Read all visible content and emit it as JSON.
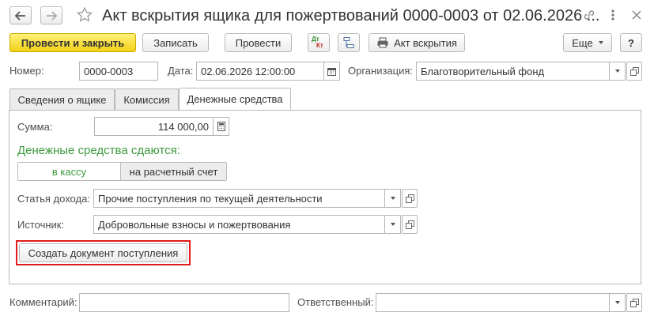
{
  "window": {
    "title": "Акт вскрытия ящика для пожертвований 0000-0003 от 02.06.2026 ..."
  },
  "icons": {
    "back": "arrow-left-icon",
    "forward": "arrow-right-icon",
    "favorite": "star-icon",
    "link": "link-icon",
    "menu": "more-vertical-icon",
    "close": "close-icon",
    "dtkt": "dt-kt-icon",
    "structure": "structure-icon",
    "print": "printer-icon",
    "calendar": "calendar-icon",
    "calculator": "calculator-icon",
    "open": "open-window-icon"
  },
  "toolbar": {
    "post_and_close": "Провести и закрыть",
    "save": "Записать",
    "post": "Провести",
    "dt_label": "Дт",
    "kt_label": "Кт",
    "act": "Акт вскрытия",
    "more": "Еще",
    "help": "?"
  },
  "header": {
    "number_label": "Номер:",
    "number_value": "0000-0003",
    "date_label": "Дата:",
    "date_value": "02.06.2026 12:00:00",
    "org_label": "Организация:",
    "org_value": "Благотворительный фонд"
  },
  "tabs": [
    {
      "label": "Сведения о ящике",
      "active": false
    },
    {
      "label": "Комиссия",
      "active": false
    },
    {
      "label": "Денежные средства",
      "active": true
    }
  ],
  "money": {
    "sum_label": "Сумма:",
    "sum_value": "114 000,00",
    "heading": "Денежные средства сдаются:",
    "option_cash": "в кассу",
    "option_account": "на расчетный счет",
    "selected_option": "в кассу",
    "income_label": "Статья дохода:",
    "income_value": "Прочие поступления по текущей деятельности",
    "source_label": "Источник:",
    "source_value": "Добровольные взносы и пожертвования",
    "create_button": "Создать документ поступления"
  },
  "footer": {
    "comment_label": "Комментарий:",
    "comment_value": "",
    "responsible_label": "Ответственный:",
    "responsible_value": ""
  },
  "colors": {
    "primary_button": "#f2cf17",
    "heading_green": "#3d9a3d",
    "highlight_red": "#e01b1b",
    "border": "#b5b5b5"
  }
}
